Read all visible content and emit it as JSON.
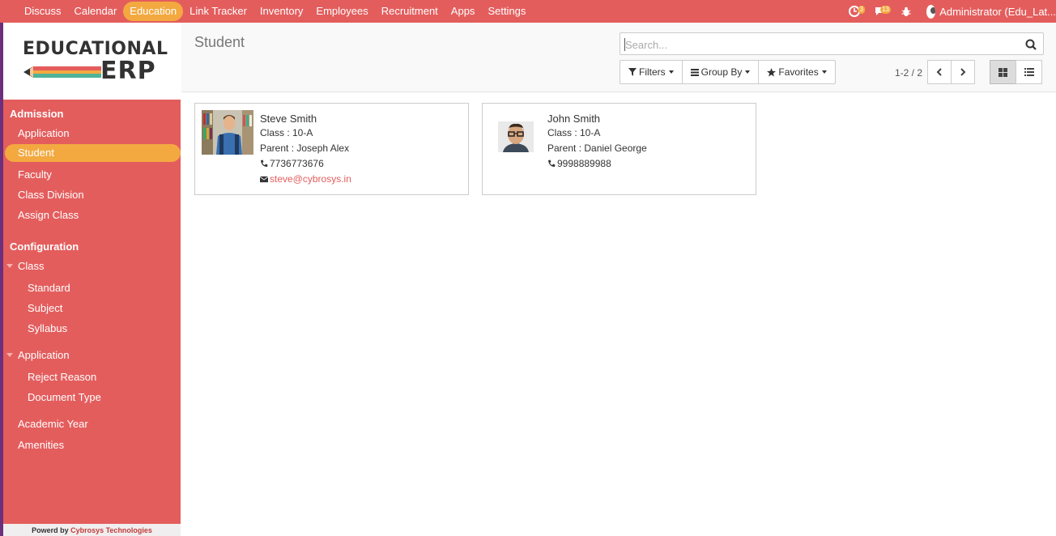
{
  "topbar": {
    "menu": [
      "Discuss",
      "Calendar",
      "Education",
      "Link Tracker",
      "Inventory",
      "Employees",
      "Recruitment",
      "Apps",
      "Settings"
    ],
    "active": "Education",
    "activity_count": "3",
    "messages_count": "13",
    "user": "Administrator (Edu_Lat..."
  },
  "logo": {
    "line1": "EDUCATIONAL",
    "line2": "ERP"
  },
  "sidebar": {
    "admission_header": "Admission",
    "admission_items": [
      "Application",
      "Student",
      "Faculty",
      "Class Division",
      "Assign Class"
    ],
    "config_header": "Configuration",
    "class_group": "Class",
    "class_items": [
      "Standard",
      "Subject",
      "Syllabus"
    ],
    "application_group": "Application",
    "application_items": [
      "Reject Reason",
      "Document Type"
    ],
    "other_items": [
      "Academic Year",
      "Amenities"
    ],
    "powered_prefix": "Powerd by ",
    "powered_company": "Cybrosys Technologies"
  },
  "control_panel": {
    "title": "Student",
    "search_placeholder": "Search...",
    "filters_label": "Filters",
    "groupby_label": "Group By",
    "favorites_label": "Favorites",
    "pager": "1-2 / 2"
  },
  "students": [
    {
      "name": "Steve Smith",
      "class": "Class : 10-A",
      "parent": "Parent : Joseph Alex",
      "phone": "7736773676",
      "email": "steve@cybrosys.in"
    },
    {
      "name": "John Smith",
      "class": "Class : 10-A",
      "parent": "Parent : Daniel George",
      "phone": "9998889988"
    }
  ],
  "colors": {
    "brand": "#e45d5d",
    "accent": "#f3a940"
  }
}
